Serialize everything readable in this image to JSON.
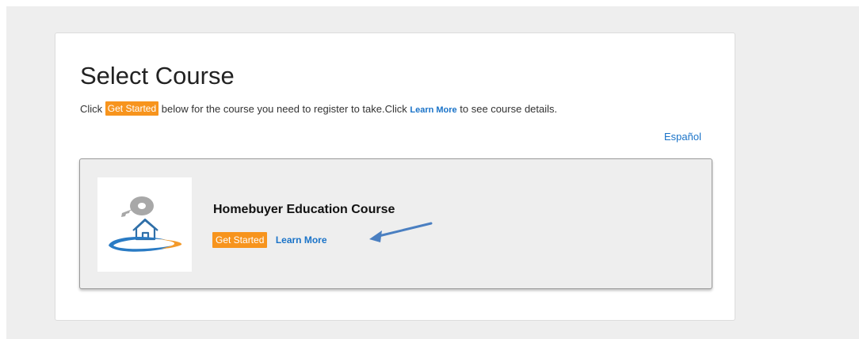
{
  "page": {
    "title": "Select Course",
    "instructions": {
      "prefix": "Click ",
      "get_started_badge": "Get Started",
      "middle": " below for the course you need to register to take.Click ",
      "learn_more_link": "Learn More",
      "suffix": "  to see course details."
    },
    "language_link": "Español"
  },
  "course": {
    "title": "Homebuyer Education Course",
    "get_started_label": "Get Started",
    "learn_more_label": "Learn More",
    "thumbnail_icon": "house-key-icon"
  },
  "colors": {
    "accent_orange": "#f7941d",
    "link_blue": "#1a73c8",
    "annotation_arrow": "#4a7fc1"
  }
}
